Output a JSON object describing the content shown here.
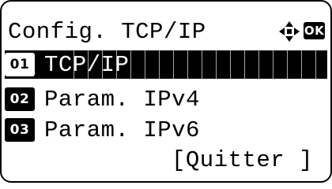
{
  "screen": {
    "title": "Config. TCP/IP",
    "ok_key": "OK",
    "icons": {
      "nav": "four-way-arrow-icon"
    }
  },
  "menu": {
    "items": [
      {
        "number": "01",
        "label": "TCP/IP",
        "selected": true
      },
      {
        "number": "02",
        "label": "Param. IPv4",
        "selected": false
      },
      {
        "number": "03",
        "label": "Param. IPv6",
        "selected": false
      }
    ]
  },
  "footer": {
    "softkey_label": "[Quitter ]"
  }
}
